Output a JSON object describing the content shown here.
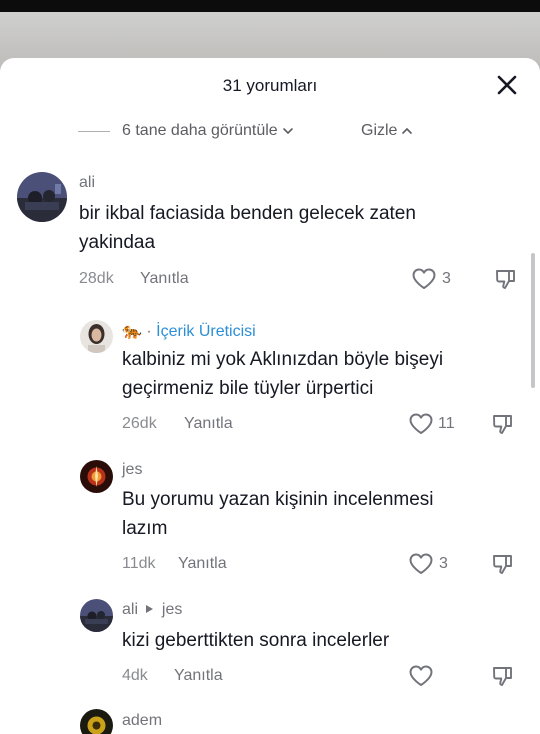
{
  "sheet": {
    "title": "31 yorumları",
    "more_replies_label": "6 tane daha görüntüle",
    "hide_label": "Gizle"
  },
  "comments": [
    {
      "author": "ali",
      "text_lines": [
        "bir ikbal faciasida benden gelecek zaten",
        "yakindaa"
      ],
      "time": "28dk",
      "reply_label": "Yanıtla",
      "likes": "3"
    },
    {
      "author_emoji": "🐅",
      "author_separator": "·",
      "author_badge": "İçerik Üreticisi",
      "text_lines": [
        "kalbiniz mi yok Aklınızdan böyle bişeyi",
        "geçirmeniz bile tüyler ürpertici"
      ],
      "time": "26dk",
      "reply_label": "Yanıtla",
      "likes": "11"
    },
    {
      "author": "jes",
      "text_lines": [
        "Bu yorumu yazan kişinin incelenmesi",
        "lazım"
      ],
      "time": "11dk",
      "reply_label": "Yanıtla",
      "likes": "3"
    },
    {
      "author": "ali",
      "reply_to": "jes",
      "text_lines": [
        "kizi geberttikten sonra incelerler"
      ],
      "time": "4dk",
      "reply_label": "Yanıtla",
      "likes": ""
    },
    {
      "author": "adem"
    }
  ],
  "colors": {
    "creator_badge": "#2c8fd6",
    "text": "#161823",
    "muted": "#73747b"
  },
  "icons": {
    "close": "close-icon",
    "like": "heart-outline-icon",
    "dislike": "thumbs-down-icon",
    "reply_arrow": "caret-right-icon"
  }
}
